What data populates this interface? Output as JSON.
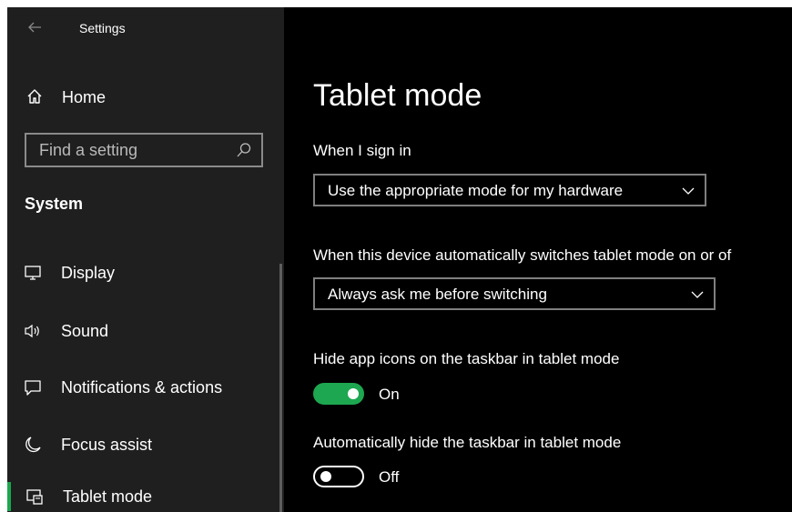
{
  "window": {
    "app_title": "Settings",
    "back_icon": "back-arrow-icon"
  },
  "sidebar": {
    "home_label": "Home",
    "search_placeholder": "Find a setting",
    "section_title": "System",
    "items": [
      {
        "label": "Display",
        "icon": "monitor-icon"
      },
      {
        "label": "Sound",
        "icon": "speaker-icon"
      },
      {
        "label": "Notifications & actions",
        "icon": "notification-icon"
      },
      {
        "label": "Focus assist",
        "icon": "moon-icon"
      },
      {
        "label": "Tablet mode",
        "icon": "tablet-mode-icon",
        "active": true
      }
    ]
  },
  "main": {
    "title": "Tablet mode",
    "sign_in": {
      "label": "When I sign in",
      "value": "Use the appropriate mode for my hardware"
    },
    "auto_switch": {
      "label": "When this device automatically switches tablet mode on or of",
      "value": "Always ask me before switching"
    },
    "hide_icons": {
      "label": "Hide app icons on the taskbar in tablet mode",
      "state": "On",
      "on": true
    },
    "hide_taskbar": {
      "label": "Automatically hide the taskbar in tablet mode",
      "state": "Off",
      "on": false
    }
  },
  "colors": {
    "accent": "#1da750",
    "sidebar_bg": "#1f1f1f",
    "main_bg": "#000000"
  }
}
